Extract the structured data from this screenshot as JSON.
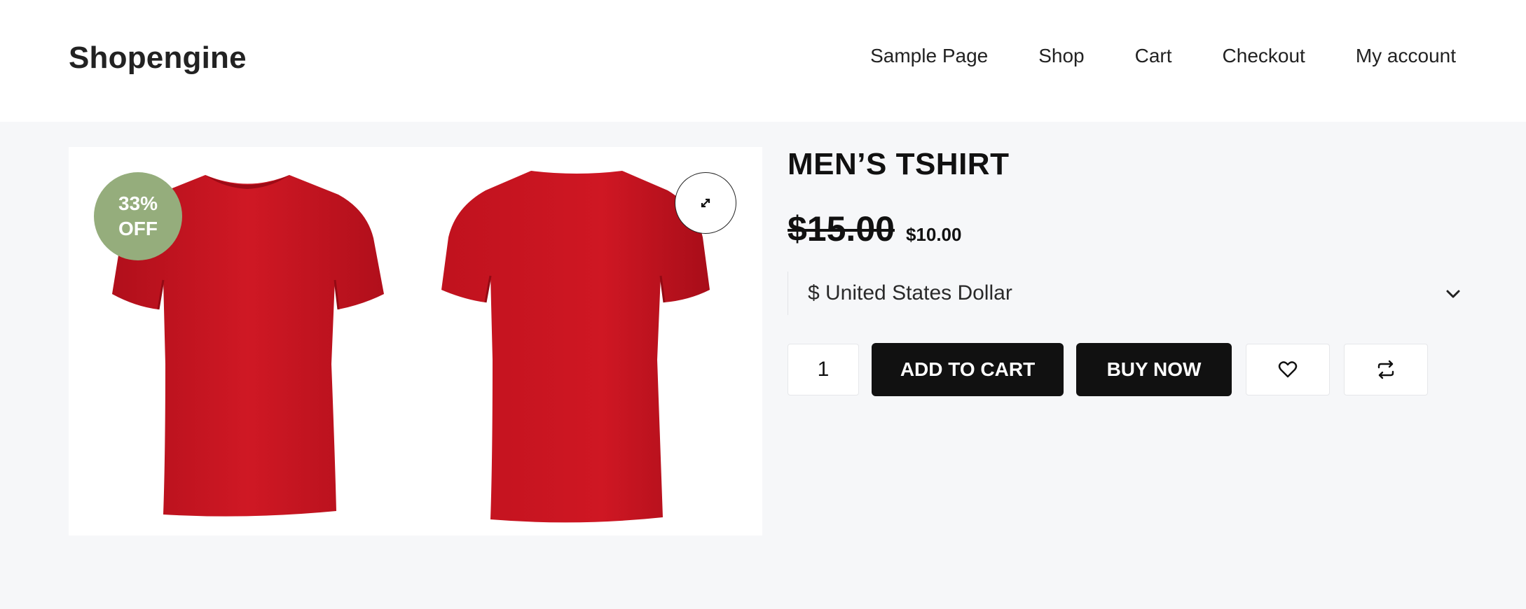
{
  "header": {
    "logo": "Shopengine",
    "nav": [
      "Sample Page",
      "Shop",
      "Cart",
      "Checkout",
      "My account"
    ]
  },
  "gallery": {
    "badge_line1": "33%",
    "badge_line2": "OFF",
    "badge_color": "#95ad7c",
    "zoom_icon": "expand-icon"
  },
  "product": {
    "title": "MEN’S TSHIRT",
    "old_price": "$15.00",
    "new_price": "$10.00",
    "currency_selected": "$ United States Dollar",
    "quantity": "1",
    "add_to_cart": "ADD TO CART",
    "buy_now": "BUY NOW",
    "wishlist_icon": "heart-icon",
    "compare_icon": "compare-arrows-icon"
  },
  "colors": {
    "shirt": "#c8141f",
    "button_dark": "#111111"
  }
}
